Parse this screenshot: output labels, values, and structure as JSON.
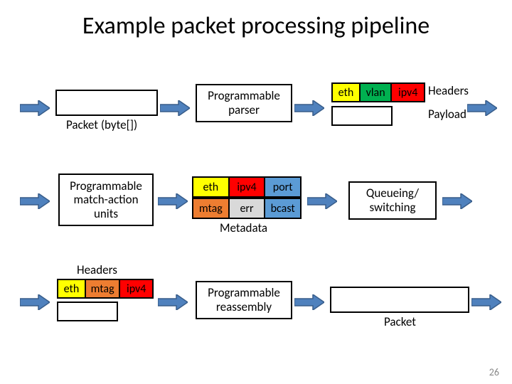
{
  "title": "Example packet processing pipeline",
  "row1": {
    "packet_label": "Packet (byte[])",
    "parser_label": "Programmable\nparser",
    "headers_cells": [
      "eth",
      "vlan",
      "ipv4"
    ],
    "headers_label": "Headers",
    "payload_label": "Payload"
  },
  "row2": {
    "mau_label": "Programmable\nmatch-action\nunits",
    "meta_top": [
      "eth",
      "ipv4",
      "port"
    ],
    "meta_bot": [
      "mtag",
      "err",
      "bcast"
    ],
    "metadata_label": "Metadata",
    "queue_label": "Queueing/\nswitching"
  },
  "row3": {
    "headers_label": "Headers",
    "out_cells": [
      "eth",
      "mtag",
      "ipv4"
    ],
    "reasm_label": "Programmable\nreassembly",
    "packet_label": "Packet"
  },
  "slide_number": "26",
  "arrow_fill": "#4f81bd",
  "arrow_stroke": "#385d8a"
}
